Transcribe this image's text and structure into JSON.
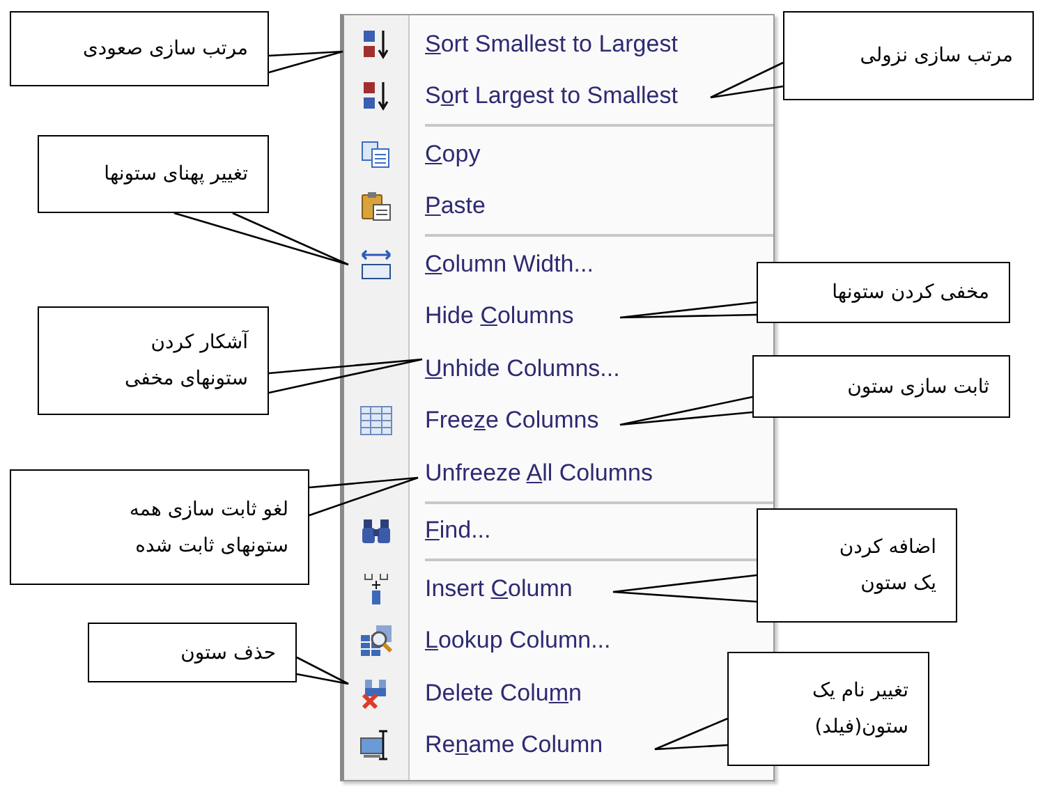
{
  "menu": {
    "items": [
      {
        "kind": "item",
        "access_key": "S",
        "label_after": "ort Smallest to Largest"
      },
      {
        "kind": "item",
        "label_before": "S",
        "access_key": "o",
        "label_after": "rt Largest to Smallest"
      },
      {
        "kind": "separator"
      },
      {
        "kind": "item",
        "access_key": "C",
        "label_after": "opy"
      },
      {
        "kind": "item",
        "access_key": "P",
        "label_after": "aste"
      },
      {
        "kind": "separator"
      },
      {
        "kind": "item",
        "access_key": "C",
        "label_after": "olumn Width..."
      },
      {
        "kind": "item",
        "label_before": "Hide ",
        "access_key": "C",
        "label_after": "olumns"
      },
      {
        "kind": "item",
        "access_key": "U",
        "label_after": "nhide Columns..."
      },
      {
        "kind": "item",
        "label_before": "Free",
        "access_key": "z",
        "label_after": "e Columns"
      },
      {
        "kind": "item",
        "label_before": "Unfreeze ",
        "access_key": "A",
        "label_after": "ll Columns"
      },
      {
        "kind": "separator"
      },
      {
        "kind": "item",
        "access_key": "F",
        "label_after": "ind..."
      },
      {
        "kind": "separator"
      },
      {
        "kind": "item",
        "label_before": "Insert ",
        "access_key": "C",
        "label_after": "olumn"
      },
      {
        "kind": "item",
        "access_key": "L",
        "label_after": "ookup Column..."
      },
      {
        "kind": "item",
        "label_before": "Delete Colu",
        "access_key": "m",
        "label_after": "n"
      },
      {
        "kind": "item",
        "label_before": "Re",
        "access_key": "n",
        "label_after": "ame Column"
      }
    ]
  },
  "left_callouts": [
    {
      "lines": [
        "مرتب سازی صعودی"
      ]
    },
    {
      "lines": [
        "تغییر پهنای ستونها"
      ]
    },
    {
      "lines": [
        "آشکار کردن",
        "ستونهای مخفی"
      ]
    },
    {
      "lines": [
        "لغو ثابت سازی همه",
        "ستونهای ثابت شده"
      ]
    },
    {
      "lines": [
        "حذف ستون"
      ]
    }
  ],
  "right_callouts": [
    {
      "lines": [
        "مرتب سازی نزولی"
      ]
    },
    {
      "lines": [
        "مخفی کردن ستونها"
      ]
    },
    {
      "lines": [
        "ثابت سازی ستون"
      ]
    },
    {
      "lines": [
        "اضافه کردن",
        "یک ستون"
      ]
    },
    {
      "lines": [
        "تغییر نام یک",
        "ستون(فیلد)"
      ]
    }
  ]
}
